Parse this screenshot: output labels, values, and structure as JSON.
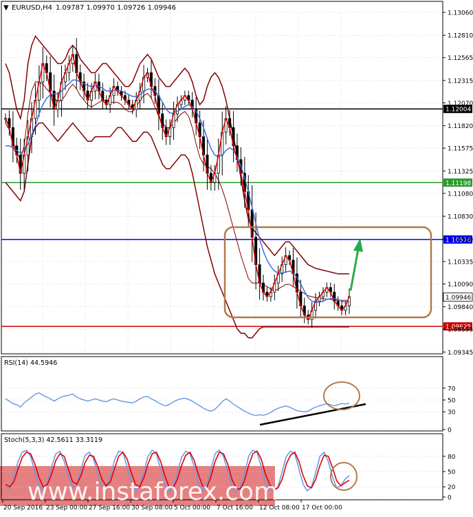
{
  "header": {
    "symbol_tf": "EURUSD,H4",
    "ohlc": "1.09787 1.09970 1.09726 1.09946"
  },
  "rsi_title": "RSI(14) 44.5946",
  "stoch_title": "Stoch(5,3,3) 42.5611 33.3119",
  "watermark": "www.instaforex.com",
  "colors": {
    "background": "#ffffff",
    "grid": "#c8c8c8",
    "candle": "#000000",
    "bollinger": "#800000",
    "ma_fast": "#e00000",
    "ma_slow": "#3c6fe0",
    "rsi_line": "#5a8fe0",
    "stoch_main": "#6a9ae6",
    "stoch_signal": "#e00000",
    "level_black": "#000000",
    "level_green": "#2a9a2a",
    "level_blue": "#0000ff",
    "level_red": "#cc0000",
    "annotation_box": "#b07a4a",
    "arrow_green": "#2aaa44",
    "watermark_bg": "#e06a6a"
  },
  "chart_data": [
    {
      "type": "candlestick",
      "title": "EURUSD,H4",
      "ylim": [
        1.0934,
        1.1306
      ],
      "y_ticks": [
        "1.13060",
        "1.12810",
        "1.12565",
        "1.12315",
        "1.12070",
        "1.11820",
        "1.11575",
        "1.11325",
        "1.11080",
        "1.10830",
        "1.10580",
        "1.10335",
        "1.10090",
        "1.09840",
        "1.09595",
        "1.09345"
      ],
      "x_ticks": [
        "20 Sep 2016",
        "23 Sep 00:00",
        "27 Sep 16:00",
        "30 Sep 08:00",
        "5 Oct 00:00",
        "7 Oct 16:00",
        "12 Oct 08:00",
        "17 Oct 00:00"
      ],
      "levels": [
        {
          "value": 1.12004,
          "label": "1.12004",
          "color": "#000000"
        },
        {
          "value": 1.11198,
          "label": "1.11198",
          "color": "#2a9a2a"
        },
        {
          "value": 1.10576,
          "label": "1.10576",
          "color": "#0000ff"
        },
        {
          "value": 1.09625,
          "label": "1.09625",
          "color": "#cc0000"
        }
      ],
      "current_price": {
        "value": 1.09946,
        "label": "1.09946"
      },
      "close_series": [
        1.119,
        1.118,
        1.116,
        1.115,
        1.113,
        1.115,
        1.117,
        1.119,
        1.121,
        1.123,
        1.125,
        1.124,
        1.122,
        1.12,
        1.121,
        1.123,
        1.124,
        1.125,
        1.126,
        1.124,
        1.123,
        1.122,
        1.121,
        1.122,
        1.123,
        1.122,
        1.121,
        1.1205,
        1.1215,
        1.1225,
        1.122,
        1.1215,
        1.121,
        1.1205,
        1.12,
        1.121,
        1.122,
        1.1235,
        1.124,
        1.1225,
        1.1215,
        1.1195,
        1.118,
        1.117,
        1.118,
        1.1195,
        1.1205,
        1.121,
        1.1215,
        1.121,
        1.12,
        1.1185,
        1.117,
        1.115,
        1.113,
        1.112,
        1.113,
        1.115,
        1.1175,
        1.119,
        1.118,
        1.116,
        1.1145,
        1.113,
        1.111,
        1.109,
        1.106,
        1.103,
        1.101,
        1.1,
        1.0995,
        1.1,
        1.101,
        1.102,
        1.103,
        1.104,
        1.1035,
        1.102,
        1.1,
        1.0985,
        1.0975,
        1.097,
        1.098,
        1.099,
        1.0995,
        1.1,
        1.1005,
        1.1,
        1.099,
        1.0985,
        1.098,
        1.0985,
        1.0995
      ],
      "bb_upper": [
        1.125,
        1.124,
        1.122,
        1.12,
        1.119,
        1.121,
        1.125,
        1.127,
        1.128,
        1.1275,
        1.127,
        1.1265,
        1.126,
        1.1255,
        1.125,
        1.125,
        1.1255,
        1.1265,
        1.127,
        1.1265,
        1.1255,
        1.125,
        1.1245,
        1.124,
        1.124,
        1.1245,
        1.125,
        1.125,
        1.1245,
        1.124,
        1.1235,
        1.123,
        1.1225,
        1.1225,
        1.123,
        1.124,
        1.125,
        1.1255,
        1.126,
        1.1255,
        1.1245,
        1.1235,
        1.123,
        1.1225,
        1.1225,
        1.123,
        1.1235,
        1.124,
        1.1245,
        1.124,
        1.123,
        1.1215,
        1.1205,
        1.121,
        1.1225,
        1.1235,
        1.124,
        1.1235,
        1.1225,
        1.121,
        1.119,
        1.117,
        1.115,
        1.1125,
        1.11,
        1.108,
        1.107,
        1.1065,
        1.106,
        1.1055,
        1.105,
        1.1045,
        1.104,
        1.1045,
        1.105,
        1.1055,
        1.1055,
        1.105,
        1.1045,
        1.104,
        1.1035,
        1.103,
        1.1028,
        1.1026,
        1.1025,
        1.1024,
        1.1023,
        1.1022,
        1.1021,
        1.102,
        1.102,
        1.102,
        1.102
      ],
      "bb_lower": [
        1.112,
        1.1115,
        1.111,
        1.1105,
        1.11,
        1.111,
        1.114,
        1.117,
        1.118,
        1.1185,
        1.1185,
        1.118,
        1.1175,
        1.117,
        1.1165,
        1.117,
        1.1175,
        1.118,
        1.1185,
        1.118,
        1.1175,
        1.117,
        1.1165,
        1.1165,
        1.117,
        1.117,
        1.117,
        1.117,
        1.117,
        1.1175,
        1.118,
        1.118,
        1.1175,
        1.117,
        1.1165,
        1.1165,
        1.117,
        1.1175,
        1.1175,
        1.117,
        1.116,
        1.115,
        1.114,
        1.1135,
        1.1135,
        1.114,
        1.1145,
        1.115,
        1.115,
        1.1145,
        1.113,
        1.111,
        1.109,
        1.107,
        1.105,
        1.1035,
        1.102,
        1.101,
        1.1,
        1.099,
        1.098,
        1.097,
        1.096,
        1.0955,
        1.0955,
        1.095,
        1.095,
        1.0955,
        1.096,
        1.0962,
        1.0962,
        1.0962,
        1.0962,
        1.0962,
        1.0962,
        1.0962,
        1.0962,
        1.0962,
        1.0962,
        1.0962,
        1.0962,
        1.0962,
        1.0962,
        1.0962,
        1.0962,
        1.0962,
        1.0962,
        1.0962,
        1.0962,
        1.0962,
        1.0962,
        1.0962,
        1.0962
      ],
      "ma_slow": [
        1.116,
        1.116,
        1.1158,
        1.1155,
        1.1152,
        1.1155,
        1.1162,
        1.1172,
        1.1182,
        1.1195,
        1.1205,
        1.1212,
        1.1216,
        1.1217,
        1.1217,
        1.122,
        1.1224,
        1.1228,
        1.1232,
        1.1232,
        1.123,
        1.1228,
        1.1226,
        1.1225,
        1.1226,
        1.1225,
        1.1223,
        1.122,
        1.122,
        1.1221,
        1.1221,
        1.122,
        1.1218,
        1.1216,
        1.1214,
        1.1214,
        1.1216,
        1.1219,
        1.1222,
        1.1222,
        1.122,
        1.1215,
        1.1208,
        1.12,
        1.1196,
        1.1196,
        1.1198,
        1.12,
        1.1203,
        1.1205,
        1.1203,
        1.1198,
        1.119,
        1.118,
        1.1168,
        1.1157,
        1.115,
        1.1148,
        1.115,
        1.1155,
        1.1158,
        1.1155,
        1.1148,
        1.1138,
        1.1125,
        1.111,
        1.1093,
        1.1075,
        1.1058,
        1.1045,
        1.1035,
        1.1028,
        1.1023,
        1.1021,
        1.1021,
        1.1022,
        1.1023,
        1.1021,
        1.1016,
        1.1009,
        1.1001,
        1.0994,
        1.099,
        1.0989,
        1.0989,
        1.099,
        1.0992,
        1.0993,
        1.0993,
        1.0992,
        1.099,
        1.0989,
        1.099
      ]
    },
    {
      "type": "line",
      "title": "RSI(14) 44.5946",
      "ylim": [
        0,
        100
      ],
      "y_ticks": [
        "70",
        "50",
        "30",
        "0"
      ],
      "values": [
        52,
        48,
        44,
        42,
        38,
        45,
        50,
        55,
        60,
        62,
        58,
        55,
        52,
        48,
        52,
        55,
        57,
        58,
        60,
        55,
        52,
        50,
        48,
        50,
        52,
        50,
        48,
        47,
        50,
        52,
        50,
        48,
        47,
        46,
        45,
        48,
        52,
        55,
        56,
        52,
        49,
        45,
        42,
        40,
        43,
        47,
        50,
        52,
        53,
        51,
        48,
        44,
        40,
        36,
        33,
        31,
        34,
        40,
        47,
        52,
        48,
        43,
        39,
        35,
        31,
        28,
        25,
        24,
        25,
        24,
        26,
        29,
        33,
        36,
        38,
        40,
        38,
        35,
        32,
        31,
        30,
        31,
        35,
        38,
        40,
        42,
        44,
        42,
        40,
        42,
        44,
        43,
        45
      ]
    },
    {
      "type": "line",
      "title": "Stoch(5,3,3) 42.5611 33.3119",
      "ylim": [
        0,
        100
      ],
      "y_ticks": [
        "80",
        "50",
        "20",
        "0"
      ],
      "series": [
        {
          "values": [
            20,
            15,
            40,
            70,
            88,
            92,
            80,
            50,
            22,
            12,
            30,
            60,
            85,
            90,
            70,
            40,
            18,
            25,
            55,
            82,
            88,
            75,
            45,
            20,
            15,
            40,
            72,
            90,
            88,
            60,
            30,
            12,
            20,
            50,
            80,
            92,
            85,
            55,
            25,
            10,
            20,
            48,
            78,
            90,
            85,
            60,
            28,
            12,
            22,
            55,
            85,
            92,
            80,
            50,
            20,
            10,
            18,
            45,
            80,
            92,
            88,
            60,
            30,
            15,
            10,
            20,
            50,
            80,
            90,
            85,
            55,
            25,
            12,
            20,
            48,
            80,
            88,
            70,
            40,
            18,
            22,
            35,
            42
          ]
        },
        {
          "values": [
            25,
            20,
            30,
            55,
            78,
            88,
            85,
            65,
            38,
            20,
            25,
            45,
            72,
            85,
            80,
            55,
            30,
            25,
            42,
            68,
            82,
            80,
            60,
            35,
            22,
            30,
            55,
            80,
            88,
            75,
            48,
            25,
            20,
            38,
            65,
            85,
            88,
            70,
            42,
            20,
            18,
            35,
            62,
            82,
            88,
            72,
            45,
            22,
            18,
            40,
            70,
            88,
            85,
            65,
            35,
            18,
            15,
            32,
            62,
            85,
            90,
            75,
            45,
            25,
            15,
            18,
            35,
            65,
            82,
            88,
            70,
            42,
            22,
            18,
            35,
            62,
            82,
            80,
            58,
            32,
            22,
            28,
            33
          ]
        }
      ]
    }
  ]
}
